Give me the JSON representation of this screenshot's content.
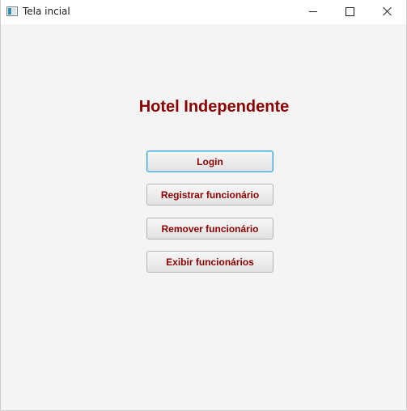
{
  "window": {
    "title": "Tela incial"
  },
  "main": {
    "heading": "Hotel Independente",
    "buttons": [
      {
        "label": "Login"
      },
      {
        "label": "Registrar funcionário"
      },
      {
        "label": "Remover funcionário"
      },
      {
        "label": "Exibir funcionários"
      }
    ]
  },
  "colors": {
    "accent": "#8b0000",
    "focus_border": "#3aa7df",
    "background": "#f4f4f4"
  },
  "icons": {
    "app": "app-window-icon",
    "minimize": "minimize-icon",
    "maximize": "maximize-icon",
    "close": "close-icon"
  }
}
